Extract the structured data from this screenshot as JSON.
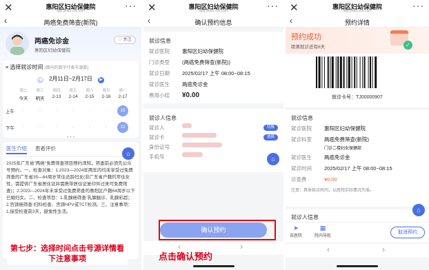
{
  "app": {
    "hospital": "惠阳区妇幼保健院",
    "url": "app.yiliao.ccb.com"
  },
  "p1": {
    "nav_title": "两癌免费筛查(新院)",
    "doctor_name": "两癌免诊金",
    "doctor_hospital": "惠阳区妇幼保健院",
    "follow": "关注",
    "select_time": "选择就诊时间",
    "select_hint": "(图内的数字代表号源数)",
    "date_range": "2月11日~2月17日",
    "weekdays": [
      "周二",
      "周三",
      "周四",
      "周五",
      "周六",
      "周日",
      "周一"
    ],
    "dates": [
      "今天",
      "明天",
      "2-13",
      "2-14",
      "2-15",
      "2-16",
      "2-17"
    ],
    "am": "上午",
    "pm": "下午",
    "am_slot": "15",
    "pm_slot": "12",
    "dash": "-",
    "tab_intro": "医生介绍",
    "tab_review": "患者评价",
    "intro_text": "2025年广东省\"两癌\"免费筛查项目预约须知，筛查前必须先公众号预约。一、检查对象：1.2023—2024年两年内均未享受过免费筛查的广东省35—64周岁常住适龄妇女(非广东省户籍的常住女性，需提供广东省居住证并需携带居住证复印件过来可免费筛查)；2.2023—2024年未享受过免费筛查的惠阳区户籍64周岁以下已婚妇女。二、检查项目：1.乳腺癌筛查:乳腺触诊、乳腺彩超；2.宫颈癌筛查:妇科检查、宫颈HPV或TCT检测。三、注意事项：1.接受检查前3天，避免性生活。",
    "caption": "第七步：选择时间点击号源详情看下注意事项"
  },
  "p2": {
    "nav_title": "确认预约信息",
    "visit_info": "就诊信息",
    "rows": [
      {
        "k": "就诊医院",
        "v": "惠阳区妇幼保健院"
      },
      {
        "k": "门诊类型",
        "v": "(两癌免费筛查(新院))"
      },
      {
        "k": "就诊日期",
        "v": "2025/02/17 上午 08:00~08:15"
      },
      {
        "k": "就诊医生",
        "v": "两癌免诊金"
      },
      {
        "k": "费用小结",
        "v": "¥0.00"
      }
    ],
    "patient_info": "就诊人信息",
    "patient_rows": [
      "就诊人",
      "就诊卡",
      "身份证号",
      "手机号"
    ],
    "switch": "切换",
    "select": "选择",
    "confirm": "确认预约",
    "caption": "点击确认预约"
  },
  "p3": {
    "nav_title": "预约详情",
    "success": "预约成功",
    "countdown": "距离就诊还有6天",
    "card_no": "就诊卡号：TJ00000907",
    "visit_info": "就诊信息",
    "rows": [
      {
        "k": "就诊医院",
        "v": "惠阳区妇幼保健院"
      },
      {
        "k": "就诊科室",
        "v": "两癌免费筛查(新院)"
      },
      {
        "k": "",
        "v": "门诊二楼妇女保健部"
      },
      {
        "k": "就诊医生",
        "v": "两癌免诊金"
      },
      {
        "k": "就诊时间",
        "v": "2025/02/17 上午 08:00~08:15"
      },
      {
        "k": "诊查费",
        "v": "¥0.00"
      }
    ],
    "note_label": "注意：",
    "note": "具体就诊时间，以医院实际情况为准。",
    "patient_info": "就诊人信息",
    "nav_go": "去医院",
    "nav_in": "院内导航",
    "cancel": "取消预约"
  },
  "colors": {
    "blue": "#4a6fe3",
    "red": "#d9001b",
    "orange": "#f25a2b"
  }
}
